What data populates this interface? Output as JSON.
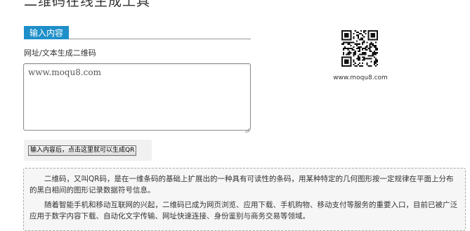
{
  "header": {
    "title": "二维码在线生成工具"
  },
  "tabs": [
    {
      "label": "输入内容"
    }
  ],
  "form": {
    "label": "网址/文本生成二维码",
    "textarea_value": "www.moqu8.com",
    "generate_button": "输入内容后，点击这里就可以生成QR"
  },
  "qr_preview": {
    "icon": "qr-code-icon",
    "caption": "www.moqu8.com"
  },
  "info": {
    "paragraphs": [
      "二维码，又叫QR码，是在一维条码的基础上扩展出的一种具有可读性的条码，用某种特定的几何图形按一定规律在平面上分布的黑白相间的图形记录数据符号信息。",
      "随着智能手机和移动互联网的兴起，二维码已成为网页浏览、应用下载、手机购物、移动支付等服务的重要入口，目前已被广泛应用于数字内容下载、自动化文字传输、网址快速连接、身份鉴别与商务交易等领域。"
    ]
  },
  "colors": {
    "tab_background": "#1f8fc9",
    "tab_text": "#ffffff",
    "info_background": "#f6f6f6",
    "info_border": "#aaaaaa"
  }
}
